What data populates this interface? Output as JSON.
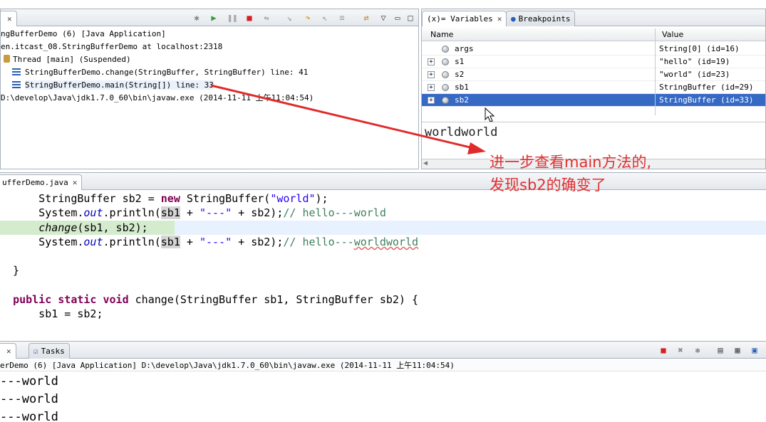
{
  "debug": {
    "tree": [
      {
        "text": "ngBufferDemo (6) [Java Application]",
        "indent": 0,
        "icon": ""
      },
      {
        "text": "en.itcast_08.StringBufferDemo at localhost:2318",
        "indent": 0,
        "icon": ""
      },
      {
        "text": "Thread [main] (Suspended)",
        "indent": 4,
        "icon": "thread-icon"
      },
      {
        "text": "StringBufferDemo.change(StringBuffer, StringBuffer) line: 41",
        "indent": 16,
        "icon": "stack-frame-icon"
      },
      {
        "text": "StringBufferDemo.main(String[]) line: 33",
        "indent": 16,
        "icon": "stack-frame-icon"
      },
      {
        "text": "D:\\develop\\Java\\jdk1.7.0_60\\bin\\javaw.exe (2014-11-11 上午11:04:54)",
        "indent": 0,
        "icon": ""
      }
    ]
  },
  "variables": {
    "tabs": {
      "variables": "(x)= Variables",
      "breakpoints": "Breakpoints"
    },
    "columns": {
      "name": "Name",
      "value": "Value"
    },
    "rows": [
      {
        "name": "args",
        "value": "String[0]  (id=16)",
        "expandable": false,
        "selected": false
      },
      {
        "name": "s1",
        "value": "\"hello\" (id=19)",
        "expandable": true,
        "selected": false
      },
      {
        "name": "s2",
        "value": "\"world\" (id=23)",
        "expandable": true,
        "selected": false
      },
      {
        "name": "sb1",
        "value": "StringBuffer  (id=29)",
        "expandable": true,
        "selected": false
      },
      {
        "name": "sb2",
        "value": "StringBuffer  (id=33)",
        "expandable": true,
        "selected": true
      }
    ],
    "detail": "worldworld"
  },
  "editor": {
    "tab": "ufferDemo.java"
  },
  "console": {
    "tab_tasks": "Tasks",
    "title": "erDemo (6) [Java Application] D:\\develop\\Java\\jdk1.7.0_60\\bin\\javaw.exe (2014-11-11 上午11:04:54)",
    "lines": [
      "---world",
      "---world",
      "---world"
    ]
  },
  "annotation": {
    "line1": "进一步查看main方法的,",
    "line2": "发现sb2的确变了",
    "color": "#e03030"
  }
}
